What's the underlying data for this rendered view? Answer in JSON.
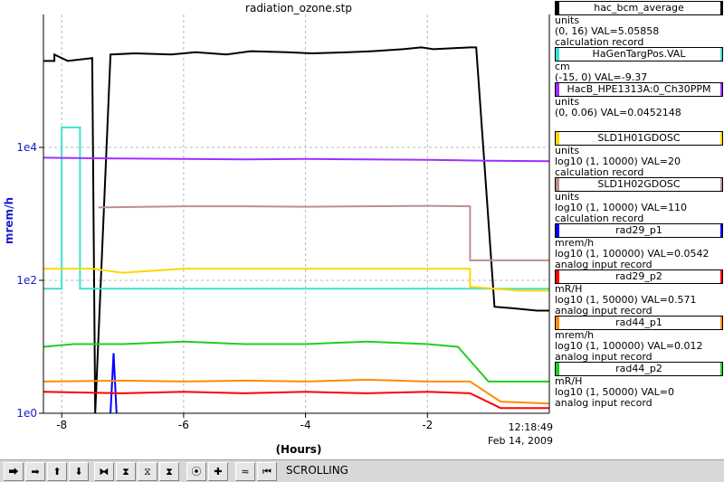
{
  "window": {
    "title": "radiation_ozone.stp"
  },
  "chart_data": {
    "type": "line",
    "title": "radiation_ozone.stp",
    "xlabel": "(Hours)",
    "ylabel": "mrem/h",
    "y_scale": "log",
    "xlim": [
      -8.3,
      0
    ],
    "ylim": [
      1,
      1000000
    ],
    "xticks": [
      -8,
      -6,
      -4,
      -2
    ],
    "x_tick_labels": [
      "-8",
      "-6",
      "-4",
      "-2"
    ],
    "yticks": [
      1,
      100,
      10000
    ],
    "y_tick_labels": [
      "1e0",
      "1e2",
      "1e4"
    ],
    "grid": true,
    "end_time": "12:18:49",
    "end_date": "Feb 14, 2009",
    "series": [
      {
        "name": "hac_bcm_average",
        "color": "#000000",
        "x": [
          -8.3,
          -8.12,
          -8.12,
          -7.9,
          -7.5,
          -7.45,
          -7.2,
          -6.8,
          -6.2,
          -5.8,
          -5.3,
          -4.9,
          -4.3,
          -3.9,
          -3.3,
          -2.9,
          -2.4,
          -2.1,
          -1.9,
          -1.6,
          -1.3,
          -1.2,
          -0.9,
          -0.6,
          -0.2,
          0
        ],
        "y": [
          200000,
          200000,
          250000,
          200000,
          220000,
          1,
          250000,
          260000,
          250000,
          270000,
          250000,
          280000,
          270000,
          260000,
          270000,
          280000,
          300000,
          320000,
          300000,
          310000,
          320000,
          320000,
          40,
          38,
          35,
          35
        ]
      },
      {
        "name": "HaGenTargPos.VAL",
        "color": "#40e0d0",
        "x": [
          -8.3,
          -8.0,
          -8.0,
          -7.7,
          -7.7,
          -7.4,
          -7.4,
          0
        ],
        "y": [
          75,
          75,
          20000,
          20000,
          75,
          75,
          75,
          75
        ]
      },
      {
        "name": "HacB_HPE1313A:0_Ch30PPM",
        "color": "#9b30ff",
        "x": [
          -8.3,
          -7.0,
          -6.0,
          -5.0,
          -4.0,
          -3.0,
          -2.0,
          -1.0,
          0
        ],
        "y": [
          7000,
          6800,
          6700,
          6600,
          6700,
          6600,
          6500,
          6300,
          6200
        ]
      },
      {
        "name": "SLD1H01GDOSC",
        "color": "#ffd700",
        "x": [
          -8.3,
          -7.5,
          -7.0,
          -6.0,
          -5.0,
          -4.0,
          -3.0,
          -2.0,
          -1.3,
          -1.3,
          -0.5,
          0
        ],
        "y": [
          150,
          150,
          130,
          150,
          150,
          150,
          150,
          150,
          150,
          80,
          70,
          70
        ]
      },
      {
        "name": "SLD1H02GDOSC",
        "color": "#bc8f8f",
        "x": [
          -7.4,
          -6.0,
          -5.0,
          -4.0,
          -3.0,
          -2.0,
          -1.3,
          -1.3,
          -0.5,
          0
        ],
        "y": [
          1250,
          1300,
          1300,
          1280,
          1300,
          1320,
          1300,
          200,
          200,
          200
        ]
      },
      {
        "name": "rad29_p1",
        "color": "#0000ff",
        "x": [
          -7.2,
          -7.15,
          -7.1
        ],
        "y": [
          1,
          8,
          1
        ]
      },
      {
        "name": "rad29_p2",
        "color": "#ff0000",
        "x": [
          -8.3,
          -7.0,
          -6.0,
          -5.0,
          -4.0,
          -3.0,
          -2.0,
          -1.3,
          -0.8,
          0
        ],
        "y": [
          2.1,
          2.0,
          2.1,
          2.0,
          2.1,
          2.0,
          2.1,
          2.0,
          1.2,
          1.2
        ]
      },
      {
        "name": "rad44_p1",
        "color": "#ff8c00",
        "x": [
          -8.3,
          -7.0,
          -6.0,
          -5.0,
          -4.0,
          -3.0,
          -2.0,
          -1.3,
          -0.8,
          0
        ],
        "y": [
          3.0,
          3.1,
          3.0,
          3.1,
          3.0,
          3.2,
          3.0,
          3.0,
          1.5,
          1.4
        ]
      },
      {
        "name": "rad44_p2",
        "color": "#22cc22",
        "x": [
          -8.3,
          -7.8,
          -7.0,
          -6.0,
          -5.0,
          -4.0,
          -3.0,
          -2.0,
          -1.5,
          -1.0,
          0
        ],
        "y": [
          10,
          11,
          11,
          12,
          11,
          11,
          12,
          11,
          10,
          3,
          3
        ]
      }
    ]
  },
  "legend": {
    "items": [
      {
        "name": "hac_bcm_average",
        "color": "#000000",
        "unit": "units",
        "range_val": "(0, 16) VAL=5.05858",
        "record": "calculation record"
      },
      {
        "name": "HaGenTargPos.VAL",
        "color": "#40e0d0",
        "unit": "cm",
        "range_val": "(-15, 0) VAL=-9.37",
        "record": ""
      },
      {
        "name": "HacB_HPE1313A:0_Ch30PPM",
        "color": "#9b30ff",
        "unit": "units",
        "range_val": "(0, 0.06) VAL=0.0452148",
        "record": ""
      },
      {
        "name": "SLD1H01GDOSC",
        "color": "#ffd700",
        "unit": "units",
        "range_val": "log10 (1, 10000) VAL=20",
        "record": "calculation record"
      },
      {
        "name": "SLD1H02GDOSC",
        "color": "#bc8f8f",
        "unit": "units",
        "range_val": "log10 (1, 10000) VAL=110",
        "record": "calculation record"
      },
      {
        "name": "rad29_p1",
        "color": "#0000ff",
        "unit": "mrem/h",
        "range_val": "log10 (1, 100000) VAL=0.0542",
        "record": "analog input record"
      },
      {
        "name": "rad29_p2",
        "color": "#ff0000",
        "unit": "mR/H",
        "range_val": "log10 (1, 50000) VAL=0.571",
        "record": "analog input record"
      },
      {
        "name": "rad44_p1",
        "color": "#ff8c00",
        "unit": "mrem/h",
        "range_val": "log10 (1, 100000) VAL=0.012",
        "record": "analog input record"
      },
      {
        "name": "rad44_p2",
        "color": "#22cc22",
        "unit": "mR/H",
        "range_val": "log10 (1, 50000) VAL=0",
        "record": "analog input record"
      }
    ]
  },
  "toolbar": {
    "status": "SCROLLING",
    "buttons": [
      {
        "icon": "arrow-left-icon",
        "glyph": "⮕"
      },
      {
        "icon": "arrow-right-icon",
        "glyph": "➡"
      },
      {
        "icon": "arrow-up-icon",
        "glyph": "⬆"
      },
      {
        "icon": "arrow-down-icon",
        "glyph": "⬇"
      },
      {
        "icon": "zoom-in-x-icon",
        "glyph": "⧓"
      },
      {
        "icon": "zoom-out-x-icon",
        "glyph": "⧗"
      },
      {
        "icon": "zoom-in-y-icon",
        "glyph": "⧖"
      },
      {
        "icon": "zoom-out-y-icon",
        "glyph": "⧗"
      },
      {
        "icon": "autoscale-icon",
        "glyph": "⦿"
      },
      {
        "icon": "default-scale-icon",
        "glyph": "✚"
      },
      {
        "icon": "stagger-icon",
        "glyph": "≈"
      },
      {
        "icon": "undo-icon",
        "glyph": "⏮"
      }
    ]
  }
}
